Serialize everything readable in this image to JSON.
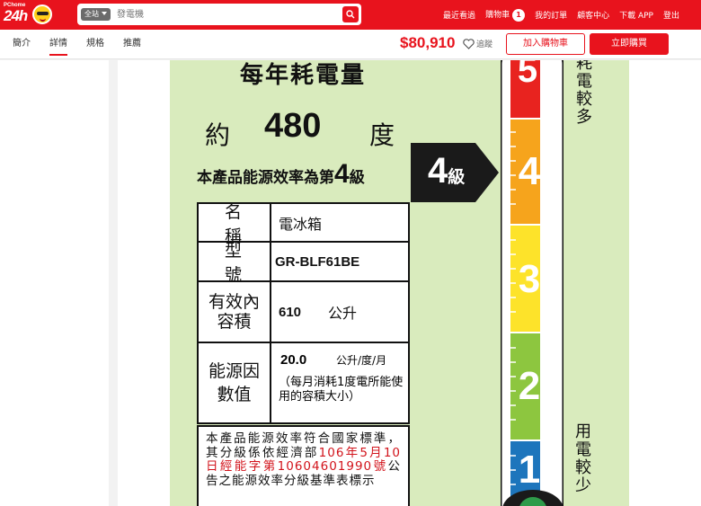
{
  "header": {
    "logo_small": "PChome",
    "logo_main": "24h",
    "search_scope": "全站",
    "search_placeholder": "發電機",
    "links": [
      "最近看過",
      "購物車",
      "我的訂單",
      "顧客中心",
      "下載 APP",
      "登出"
    ],
    "cart_count": "1"
  },
  "nav": {
    "tabs": [
      "簡介",
      "詳情",
      "規格",
      "推薦"
    ],
    "active_tab": "詳情",
    "price": "$80,910",
    "follow_label": "追蹤",
    "add_cart_label": "加入購物車",
    "buy_now_label": "立即購買"
  },
  "energy_label": {
    "title": "每年耗電量",
    "approx": "約",
    "annual_kwh": "480",
    "unit_degree": "度",
    "efficiency_prefix": "本產品能源效率為第",
    "efficiency_grade": "4",
    "efficiency_suffix": "級",
    "grade_badge_num": "4",
    "grade_badge_suffix": "級",
    "spec": {
      "name_label": "名稱",
      "name_value": "電冰箱",
      "model_label": "型號",
      "model_value": "GR-BLF61BE",
      "capacity_label": "有效內容積",
      "capacity_value": "610",
      "capacity_unit": "公升",
      "factor_label": "能源因數值",
      "factor_value": "20.0",
      "factor_unit": "公升/度/月",
      "factor_note": "（每月消耗1度電所能使用的容積大小）"
    },
    "note_line1": "本產品能源效率符合國家標準，其分級係依經濟部",
    "note_red": "106年5月10日經能字第10604601990號",
    "note_line2": "公告之能源效率分級基準表標示",
    "scale": [
      "5",
      "4",
      "3",
      "2",
      "1"
    ],
    "side_more": "耗電較多",
    "side_less": "用電較少",
    "colors": {
      "background": "#d9ebbd",
      "grade5": "#e8231f",
      "grade4": "#f6a41c",
      "grade3": "#fde32a",
      "grade2": "#8dc63f",
      "grade1": "#1d75bc"
    }
  }
}
